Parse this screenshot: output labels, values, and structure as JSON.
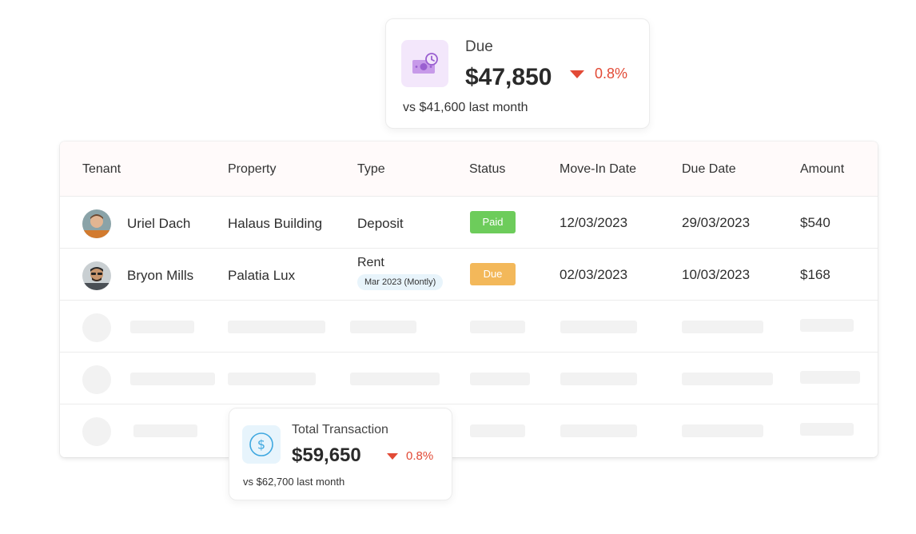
{
  "due_card": {
    "label": "Due",
    "value": "$47,850",
    "delta": "0.8%",
    "comparison": "vs $41,600 last month",
    "icon": "money-clock-icon",
    "accent": "#b07fe0"
  },
  "transaction_card": {
    "label": "Total Transaction",
    "value": "$59,650",
    "delta": "0.8%",
    "comparison": "vs $62,700 last month",
    "icon": "dollar-circle-icon",
    "accent": "#3fa8e0"
  },
  "table": {
    "headers": {
      "tenant": "Tenant",
      "property": "Property",
      "type": "Type",
      "status": "Status",
      "move_in": "Move-In Date",
      "due_date": "Due Date",
      "amount": "Amount"
    },
    "rows": [
      {
        "tenant": "Uriel Dach",
        "property": "Halaus Building",
        "type": "Deposit",
        "status": "Paid",
        "move_in": "12/03/2023",
        "due_date": "29/03/2023",
        "amount": "$540"
      },
      {
        "tenant": "Bryon Mills",
        "property": "Palatia Lux",
        "type": "Rent",
        "type_detail": "Mar 2023 (Montly)",
        "status": "Due",
        "move_in": "02/03/2023",
        "due_date": "10/03/2023",
        "amount": "$168"
      }
    ]
  },
  "colors": {
    "paid": "#6dcc5b",
    "due": "#f3b85a",
    "negative": "#e24a36"
  }
}
